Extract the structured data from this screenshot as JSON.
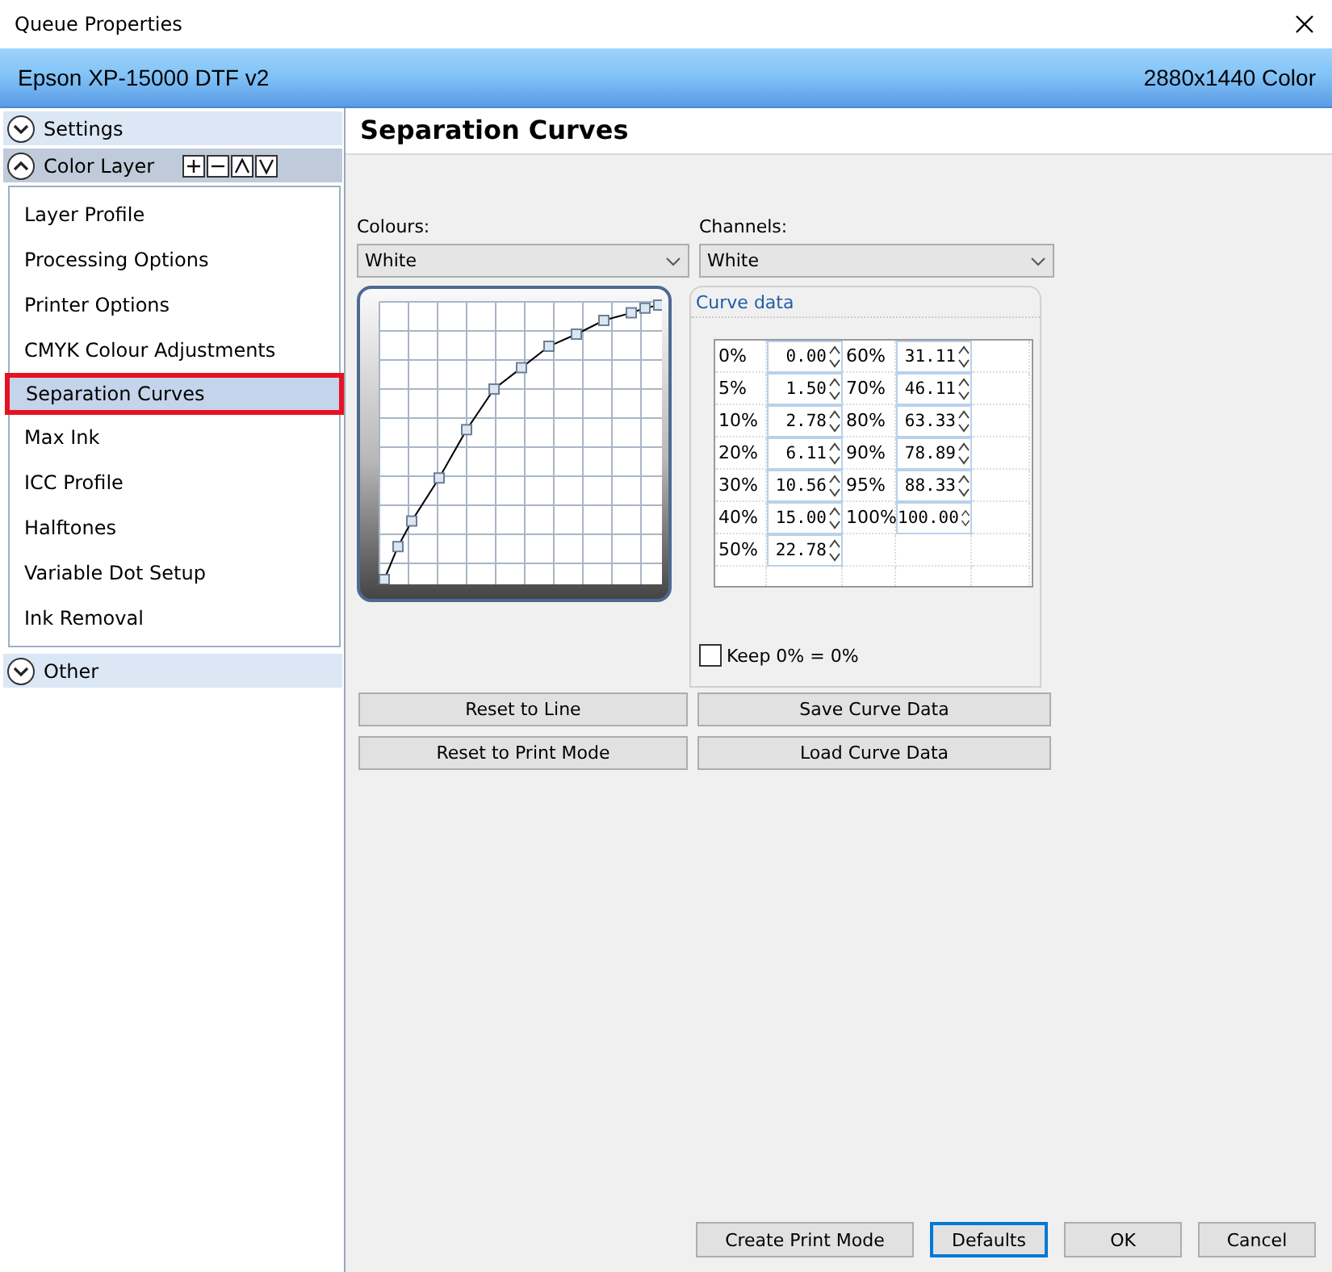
{
  "window": {
    "title": "Queue Properties"
  },
  "header": {
    "printer": "Epson XP-15000 DTF v2",
    "mode": "2880x1440 Color"
  },
  "sidebar": {
    "sections": [
      {
        "label": "Settings",
        "expanded": false
      },
      {
        "label": "Color Layer",
        "expanded": true,
        "items": [
          {
            "label": "Layer Profile",
            "selected": false
          },
          {
            "label": "Processing Options",
            "selected": false
          },
          {
            "label": "Printer Options",
            "selected": false
          },
          {
            "label": "CMYK Colour Adjustments",
            "selected": false
          },
          {
            "label": "Separation Curves",
            "selected": true
          },
          {
            "label": "Max Ink",
            "selected": false
          },
          {
            "label": "ICC Profile",
            "selected": false
          },
          {
            "label": "Halftones",
            "selected": false
          },
          {
            "label": "Variable Dot Setup",
            "selected": false
          },
          {
            "label": "Ink Removal",
            "selected": false
          }
        ]
      },
      {
        "label": "Other",
        "expanded": false
      }
    ]
  },
  "page_title": "Separation Curves",
  "colours": {
    "label": "Colours:",
    "value": "White"
  },
  "channels": {
    "label": "Channels:",
    "value": "White"
  },
  "curve_data": {
    "title": "Curve data",
    "rows": [
      {
        "percent": "0%",
        "value": "0.00"
      },
      {
        "percent": "5%",
        "value": "1.50"
      },
      {
        "percent": "10%",
        "value": "2.78"
      },
      {
        "percent": "20%",
        "value": "6.11"
      },
      {
        "percent": "30%",
        "value": "10.56"
      },
      {
        "percent": "40%",
        "value": "15.00"
      },
      {
        "percent": "50%",
        "value": "22.78"
      },
      {
        "percent": "60%",
        "value": "31.11"
      },
      {
        "percent": "70%",
        "value": "46.11"
      },
      {
        "percent": "80%",
        "value": "63.33"
      },
      {
        "percent": "90%",
        "value": "78.89"
      },
      {
        "percent": "95%",
        "value": "88.33"
      },
      {
        "percent": "100%",
        "value": "100.00"
      }
    ],
    "keep_zero": {
      "label": "Keep 0% = 0%",
      "checked": false
    }
  },
  "curve_buttons": [
    "Reset to Line",
    "Save Curve Data",
    "Reset to Print Mode",
    "Load Curve Data"
  ],
  "footer_buttons": [
    {
      "label": "Create Print Mode",
      "focused": false
    },
    {
      "label": "Defaults",
      "focused": true
    },
    {
      "label": "OK",
      "focused": false
    },
    {
      "label": "Cancel",
      "focused": false
    }
  ]
}
